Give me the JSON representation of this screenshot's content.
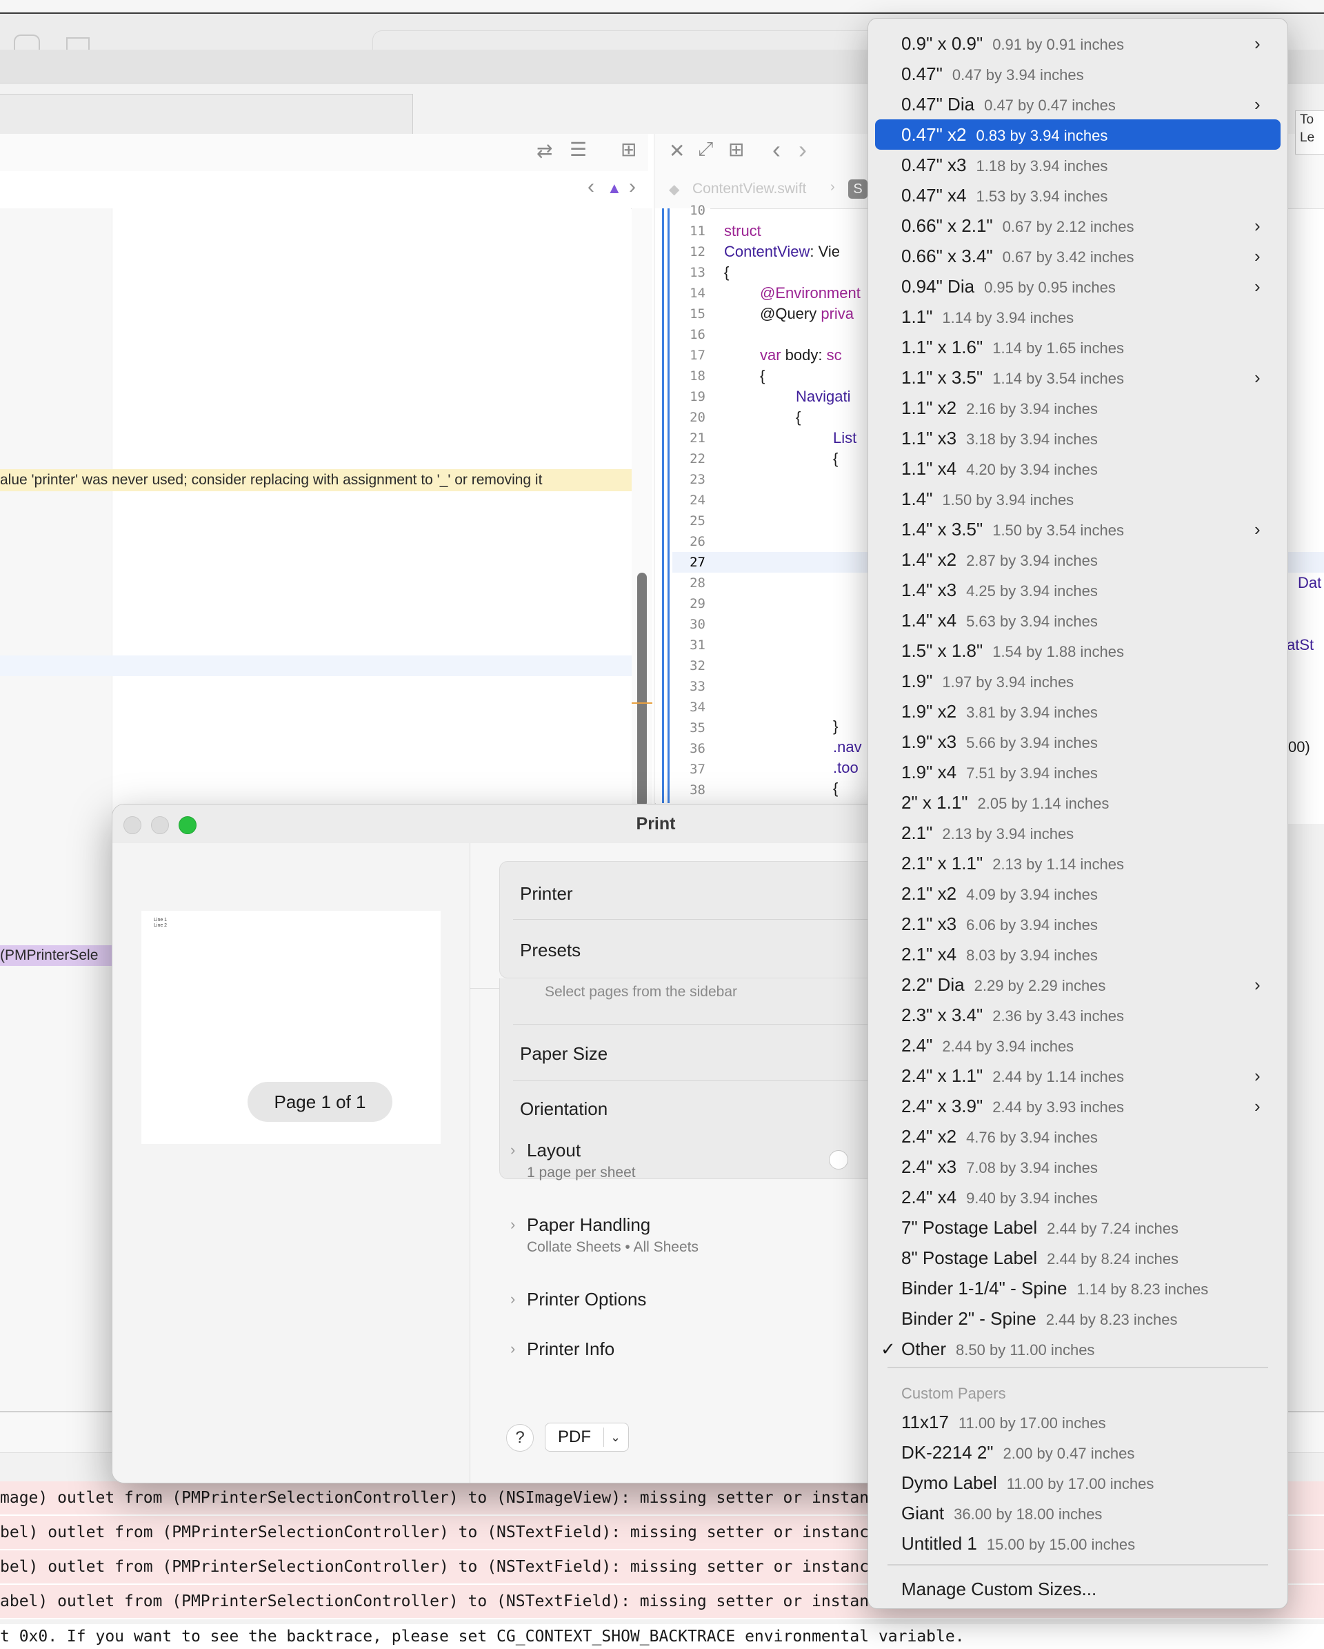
{
  "print_dialog": {
    "title": "Print",
    "page_indicator": "Page 1 of 1",
    "preview_lines": [
      "Line 1",
      "Line 2"
    ],
    "rows": {
      "printer": "Printer",
      "presets": "Presets",
      "pages_hint": "Select pages from the sidebar",
      "paper_size": "Paper Size",
      "orientation": "Orientation"
    },
    "sections": [
      {
        "label": "Layout",
        "detail": "1 page per sheet"
      },
      {
        "label": "Paper Handling",
        "detail": "Collate Sheets • All Sheets"
      },
      {
        "label": "Printer Options",
        "detail": ""
      },
      {
        "label": "Printer Info",
        "detail": ""
      }
    ],
    "help_label": "?",
    "pdf_label": "PDF"
  },
  "editor": {
    "warning_text": "alue 'printer' was never used; consider replacing with assignment to '_' or removing it",
    "purple_text": "(PMPrinterSele",
    "right_tab": [
      "To",
      "Le"
    ],
    "jump_file": "ContentView.swift",
    "jump_badge": "S",
    "line_numbers": [
      "10",
      "11",
      "12",
      "13",
      "14",
      "15",
      "16",
      "17",
      "18",
      "19",
      "20",
      "21",
      "22",
      "23",
      "24",
      "25",
      "26",
      "27",
      "28",
      "29",
      "30",
      "31",
      "32",
      "33",
      "34",
      "35",
      "36",
      "37",
      "38"
    ],
    "code": {
      "l11": "struct",
      "l12a": "ContentView",
      "l12b": ": Vie",
      "l13": "{",
      "l14": "@Environment",
      "l15a": "@Query",
      "l15b": " priva",
      "l17a": "var",
      "l17b": " body: ",
      "l17c": "sc",
      "l18": "{",
      "l19": "Navigati",
      "l20": "{",
      "l21": "List",
      "l22": "{",
      "l35": "}",
      "l36": ".nav",
      "l37": ".too",
      "l38": "{",
      "frag_dat": "Dat",
      "frag_atst": "atSt",
      "frag_00": "00)"
    }
  },
  "console": {
    "rows": [
      "mage) outlet from (PMPrinterSelectionController) to (NSImageView): missing setter or instance",
      "bel) outlet from (PMPrinterSelectionController) to (NSTextField): missing setter or instance",
      "bel) outlet from (PMPrinterSelectionController) to (NSTextField): missing setter or instance",
      "abel) outlet from (PMPrinterSelectionController) to (NSTextField): missing setter or instance"
    ],
    "bottom": "t 0x0. If you want to see the backtrace, please set CG_CONTEXT_SHOW_BACKTRACE environmental variable."
  },
  "menu": {
    "items": [
      {
        "name": "0.9\" x 0.9\"",
        "size": "0.91 by 0.91 inches",
        "submenu": true
      },
      {
        "name": "0.47\"",
        "size": "0.47 by 3.94 inches",
        "submenu": false
      },
      {
        "name": "0.47\" Dia",
        "size": "0.47 by 0.47 inches",
        "submenu": true
      },
      {
        "name": "0.47\" x2",
        "size": "0.83 by 3.94 inches",
        "submenu": false,
        "selected": true
      },
      {
        "name": "0.47\" x3",
        "size": "1.18 by 3.94 inches",
        "submenu": false
      },
      {
        "name": "0.47\" x4",
        "size": "1.53 by 3.94 inches",
        "submenu": false
      },
      {
        "name": "0.66\" x 2.1\"",
        "size": "0.67 by 2.12 inches",
        "submenu": true
      },
      {
        "name": "0.66\" x 3.4\"",
        "size": "0.67 by 3.42 inches",
        "submenu": true
      },
      {
        "name": "0.94\" Dia",
        "size": "0.95 by 0.95 inches",
        "submenu": true
      },
      {
        "name": "1.1\"",
        "size": "1.14 by 3.94 inches",
        "submenu": false
      },
      {
        "name": "1.1\" x 1.6\"",
        "size": "1.14 by 1.65 inches",
        "submenu": false
      },
      {
        "name": "1.1\" x 3.5\"",
        "size": "1.14 by 3.54 inches",
        "submenu": true
      },
      {
        "name": "1.1\" x2",
        "size": "2.16 by 3.94 inches",
        "submenu": false
      },
      {
        "name": "1.1\" x3",
        "size": "3.18 by 3.94 inches",
        "submenu": false
      },
      {
        "name": "1.1\" x4",
        "size": "4.20 by 3.94 inches",
        "submenu": false
      },
      {
        "name": "1.4\"",
        "size": "1.50 by 3.94 inches",
        "submenu": false
      },
      {
        "name": "1.4\" x 3.5\"",
        "size": "1.50 by 3.54 inches",
        "submenu": true
      },
      {
        "name": "1.4\" x2",
        "size": "2.87 by 3.94 inches",
        "submenu": false
      },
      {
        "name": "1.4\" x3",
        "size": "4.25 by 3.94 inches",
        "submenu": false
      },
      {
        "name": "1.4\" x4",
        "size": "5.63 by 3.94 inches",
        "submenu": false
      },
      {
        "name": "1.5\" x 1.8\"",
        "size": "1.54 by 1.88 inches",
        "submenu": false
      },
      {
        "name": "1.9\"",
        "size": "1.97 by 3.94 inches",
        "submenu": false
      },
      {
        "name": "1.9\" x2",
        "size": "3.81 by 3.94 inches",
        "submenu": false
      },
      {
        "name": "1.9\" x3",
        "size": "5.66 by 3.94 inches",
        "submenu": false
      },
      {
        "name": "1.9\" x4",
        "size": "7.51 by 3.94 inches",
        "submenu": false
      },
      {
        "name": "2\" x 1.1\"",
        "size": "2.05 by 1.14 inches",
        "submenu": false
      },
      {
        "name": "2.1\"",
        "size": "2.13 by 3.94 inches",
        "submenu": false
      },
      {
        "name": "2.1\" x 1.1\"",
        "size": "2.13 by 1.14 inches",
        "submenu": false
      },
      {
        "name": "2.1\" x2",
        "size": "4.09 by 3.94 inches",
        "submenu": false
      },
      {
        "name": "2.1\" x3",
        "size": "6.06 by 3.94 inches",
        "submenu": false
      },
      {
        "name": "2.1\" x4",
        "size": "8.03 by 3.94 inches",
        "submenu": false
      },
      {
        "name": "2.2\" Dia",
        "size": "2.29 by 2.29 inches",
        "submenu": true
      },
      {
        "name": "2.3\" x 3.4\"",
        "size": "2.36 by 3.43 inches",
        "submenu": false
      },
      {
        "name": "2.4\"",
        "size": "2.44 by 3.94 inches",
        "submenu": false
      },
      {
        "name": "2.4\" x 1.1\"",
        "size": "2.44 by 1.14 inches",
        "submenu": true
      },
      {
        "name": "2.4\" x 3.9\"",
        "size": "2.44 by 3.93 inches",
        "submenu": true
      },
      {
        "name": "2.4\" x2",
        "size": "4.76 by 3.94 inches",
        "submenu": false
      },
      {
        "name": "2.4\" x3",
        "size": "7.08 by 3.94 inches",
        "submenu": false
      },
      {
        "name": "2.4\" x4",
        "size": "9.40 by 3.94 inches",
        "submenu": false
      },
      {
        "name": "7\" Postage Label",
        "size": "2.44 by 7.24 inches",
        "submenu": false
      },
      {
        "name": "8\" Postage Label",
        "size": "2.44 by 8.24 inches",
        "submenu": false
      },
      {
        "name": "Binder 1-1/4\" - Spine",
        "size": "1.14 by 8.23 inches",
        "submenu": false
      },
      {
        "name": "Binder 2\" - Spine",
        "size": "2.44 by 8.23 inches",
        "submenu": false
      },
      {
        "name": "Other",
        "size": "8.50 by 11.00 inches",
        "submenu": false,
        "checked": true
      }
    ],
    "custom_header": "Custom Papers",
    "custom_items": [
      {
        "name": "11x17",
        "size": "11.00 by 17.00 inches"
      },
      {
        "name": "DK-2214 2\"",
        "size": "2.00 by 0.47 inches"
      },
      {
        "name": "Dymo Label",
        "size": "11.00 by 17.00 inches"
      },
      {
        "name": "Giant",
        "size": "36.00 by 18.00 inches"
      },
      {
        "name": "Untitled 1",
        "size": "15.00 by 15.00 inches"
      }
    ],
    "manage_label": "Manage Custom Sizes...",
    "arrow_glyph": "›",
    "check_glyph": "✓"
  },
  "colors": {
    "selection": "#1f63d6",
    "warning": "#fbf1c6",
    "console_error": "#fbe5e5",
    "keyword": "#9b2393",
    "type": "#3f1f9a"
  }
}
